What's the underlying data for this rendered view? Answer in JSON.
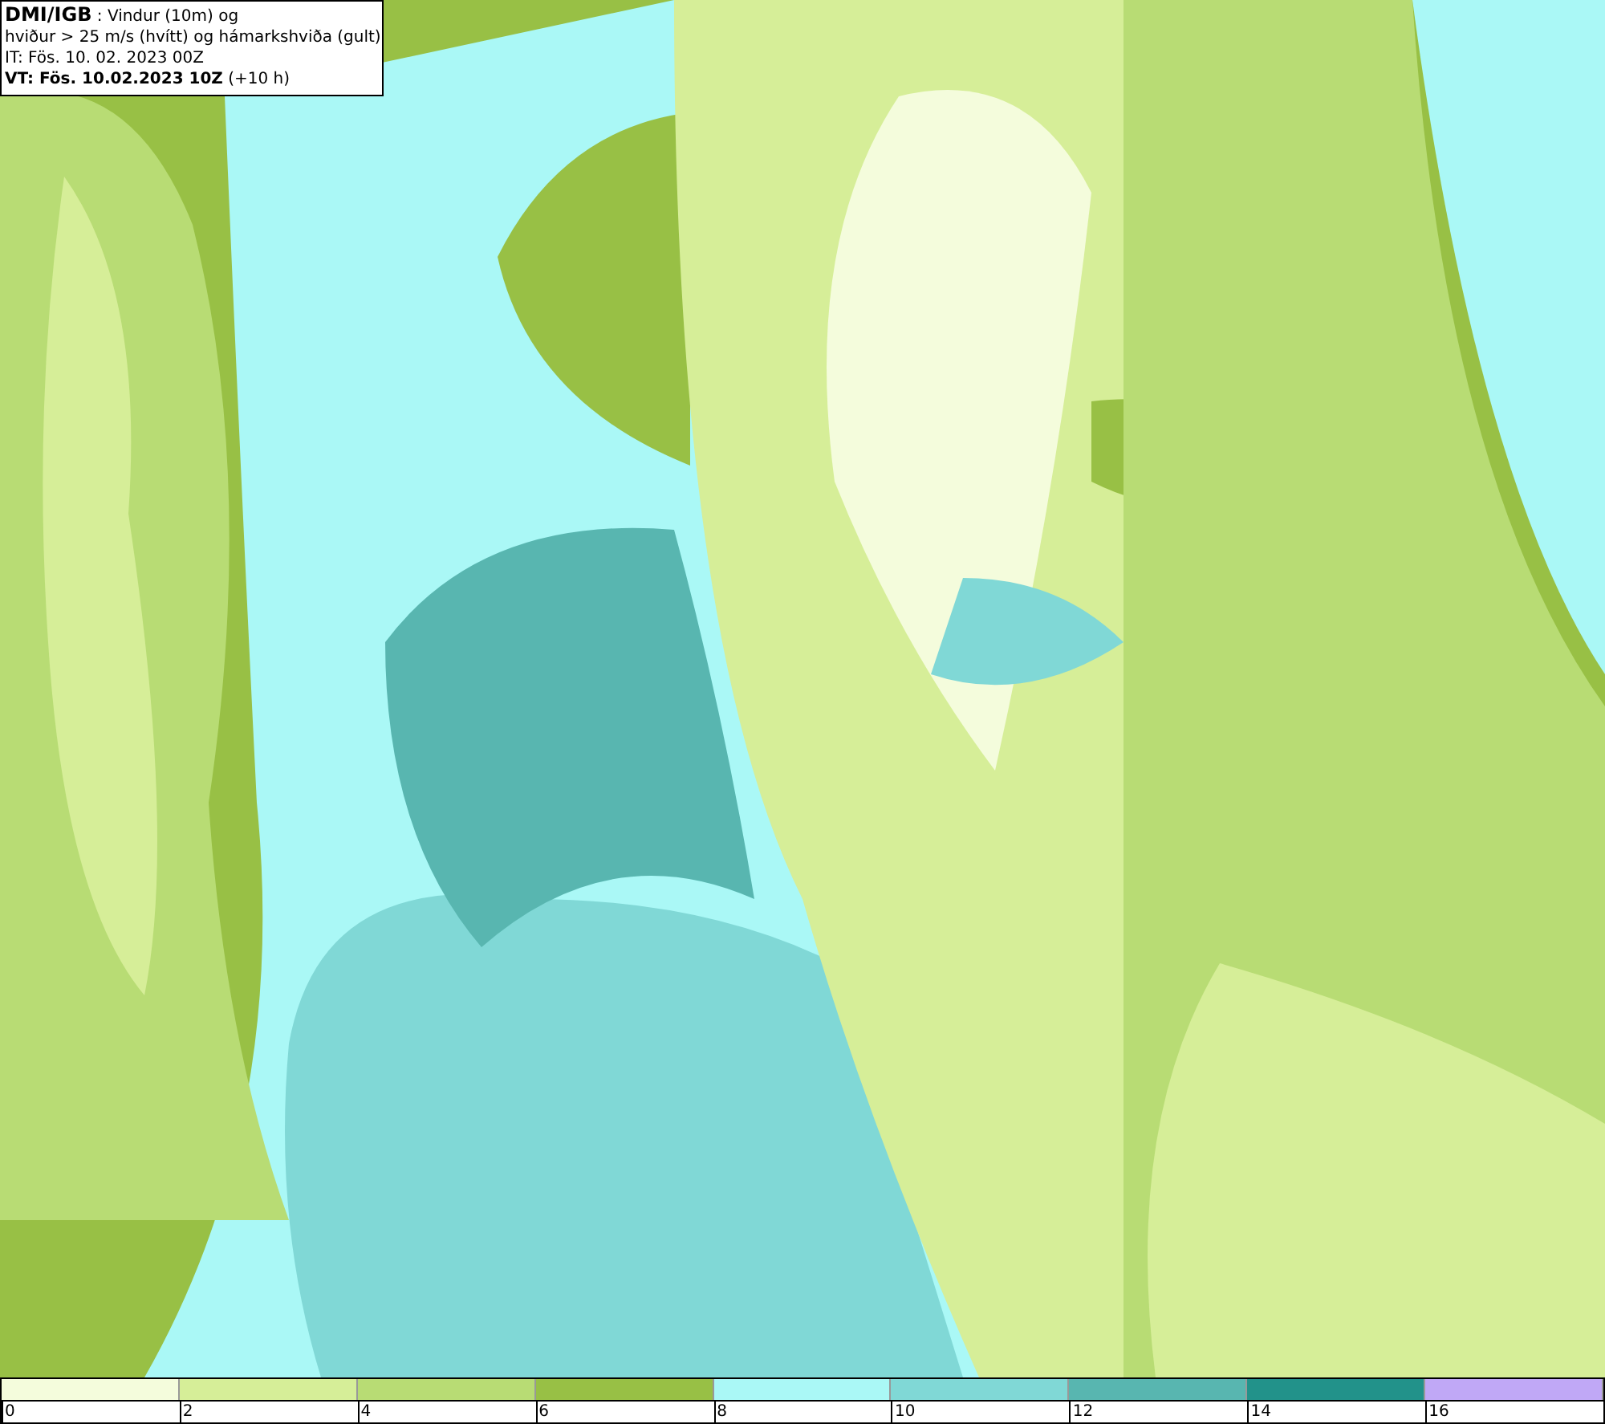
{
  "title_box": {
    "lines": [
      "**DMI/IGB** : Vindur (10m) og",
      "hviður > 25 m/s (hvítt) og hámarkshviða (gult)",
      "IT: Fös. 10. 02. 2023 00Z",
      "**VT: Fös. 10.02.2023 10Z** (+10 h)"
    ]
  },
  "legend": {
    "bins": [
      {
        "color": "#f4fcdc"
      },
      {
        "color": "#d6ee98"
      },
      {
        "color": "#b8dc74"
      },
      {
        "color": "#98c045"
      },
      {
        "color": "#aaf8f6"
      },
      {
        "color": "#80d8d6"
      },
      {
        "color": "#58b6b0"
      },
      {
        "color": "#22928a"
      },
      {
        "color": "#c0a8f6"
      }
    ],
    "ticks": [
      "0",
      "2",
      "4",
      "6",
      "8",
      "10",
      "12",
      "14",
      "16"
    ]
  }
}
